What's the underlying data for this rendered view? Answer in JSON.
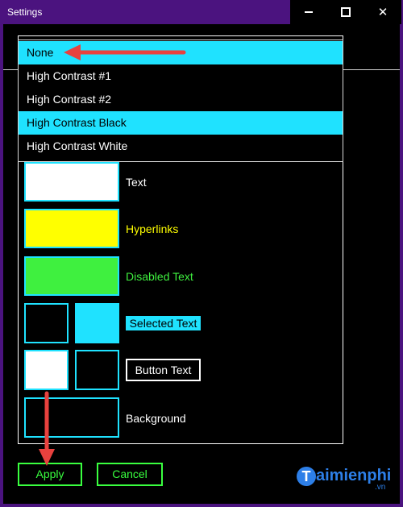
{
  "window": {
    "title": "Settings"
  },
  "dropdown": {
    "options": [
      {
        "label": "None",
        "selected": true
      },
      {
        "label": "High Contrast #1",
        "selected": false
      },
      {
        "label": "High Contrast #2",
        "selected": false
      },
      {
        "label": "High Contrast Black",
        "selected": true
      },
      {
        "label": "High Contrast White",
        "selected": false
      }
    ]
  },
  "colors": {
    "text_swatch": "#ffffff",
    "hyperlinks_swatch": "#ffff00",
    "disabled_swatch": "#3ff03f",
    "selected_bg_swatch": "#000000",
    "selected_fg_swatch": "#1fe2ff",
    "button_bg_swatch": "#ffffff",
    "button_fg_swatch": "#000000",
    "background_swatch": "#000000",
    "accent": "#1fe2ff",
    "hyperlink_text": "#ffff00",
    "disabled_text": "#3ff03f"
  },
  "rows": {
    "text_label": "Text",
    "hyperlinks_label": "Hyperlinks",
    "disabled_label": "Disabled Text",
    "selected_label": "Selected Text",
    "button_label": "Button Text",
    "background_label": "Background"
  },
  "actions": {
    "apply": "Apply",
    "cancel": "Cancel"
  },
  "watermark": {
    "logo_letter": "T",
    "brand": "aimienphi",
    "suffix": ".vn"
  }
}
